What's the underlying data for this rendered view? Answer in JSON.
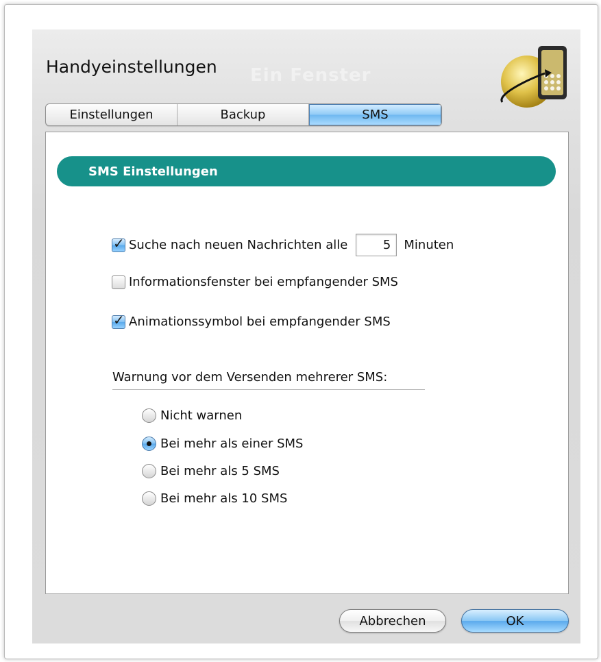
{
  "window": {
    "title": "Handyeinstellungen",
    "ghost_title": "Ein Fenster"
  },
  "tabs": [
    {
      "label": "Einstellungen",
      "active": false
    },
    {
      "label": "Backup",
      "active": false
    },
    {
      "label": "SMS",
      "active": true
    }
  ],
  "section": {
    "title": "SMS Einstellungen"
  },
  "options": {
    "check_new": {
      "label": "Suche nach neuen Nachrichten alle",
      "checked": true,
      "value": "5",
      "unit": "Minuten"
    },
    "info_window": {
      "label": "Informationsfenster bei empfangender SMS",
      "checked": false
    },
    "anim_icon": {
      "label": "Animationssymbol bei empfangender SMS",
      "checked": true
    }
  },
  "warning": {
    "label": "Warnung vor dem Versenden mehrerer SMS:",
    "choices": [
      {
        "label": "Nicht warnen",
        "selected": false
      },
      {
        "label": "Bei mehr als einer SMS",
        "selected": true
      },
      {
        "label": "Bei mehr als 5 SMS",
        "selected": false
      },
      {
        "label": "Bei mehr als 10 SMS",
        "selected": false
      }
    ]
  },
  "buttons": {
    "cancel": "Abbrechen",
    "ok": "OK"
  },
  "icons": {
    "app": "phone-globe-icon",
    "checkmark": "checkmark-icon"
  },
  "colors": {
    "section_header": "#17918a",
    "accent_blue": "#6fb8f0"
  }
}
